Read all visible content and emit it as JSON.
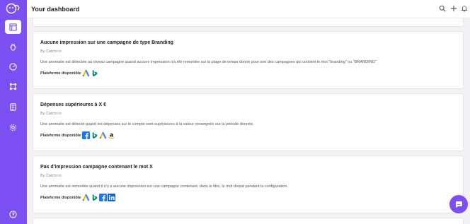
{
  "header": {
    "title": "Your dashboard"
  },
  "sidebar": {
    "items": [
      {
        "icon": "dashboard-icon",
        "active": true
      },
      {
        "icon": "bug-icon"
      },
      {
        "icon": "gauge-icon"
      },
      {
        "icon": "nodes-icon"
      },
      {
        "icon": "document-icon"
      },
      {
        "icon": "gear-icon"
      }
    ],
    "help_icon": "help-icon"
  },
  "cards": [
    {
      "title": "Aucune impression sur une campagne de type Branding",
      "by": "By Catchr.io",
      "description": "Une anomalie est détectée au niveau campagne quand aucune impression n'a été remontée sur la plage de temps donné pour une des campagnes qui contient le mot \"branding\" ou \"BRANDING\"",
      "platform_label": "Plateforme disponible",
      "platforms": [
        "google-ads",
        "bing"
      ]
    },
    {
      "title": "Dépenses supérieures à X €",
      "by": "By Catchr.io",
      "description": "Une anomalie est détecté quand les dépenses sur le compte sont supérieures à la valeur renseignée sur la période donnée.",
      "platform_label": "Plateforme disponible",
      "platforms": [
        "facebook",
        "bing",
        "google-ads",
        "amazon"
      ]
    },
    {
      "title": "Pas d'impression campagne contenant le mot X",
      "by": "By Catchr.io",
      "description": "Une anomalie est remontée quand il n'y a aucune impression sur une campagne contenant, dans le titre, le mot donné pendant la configuration.",
      "platform_label": "Plateforme disponible",
      "platforms": [
        "google-ads",
        "bing",
        "facebook",
        "linkedin"
      ]
    }
  ],
  "colors": {
    "accent": "#7b4ff2",
    "google_blue": "#4285f4",
    "google_yellow": "#fbbc04",
    "google_green": "#34a853",
    "bing": "#008373",
    "facebook": "#1877f2",
    "linkedin": "#0a66c2"
  }
}
